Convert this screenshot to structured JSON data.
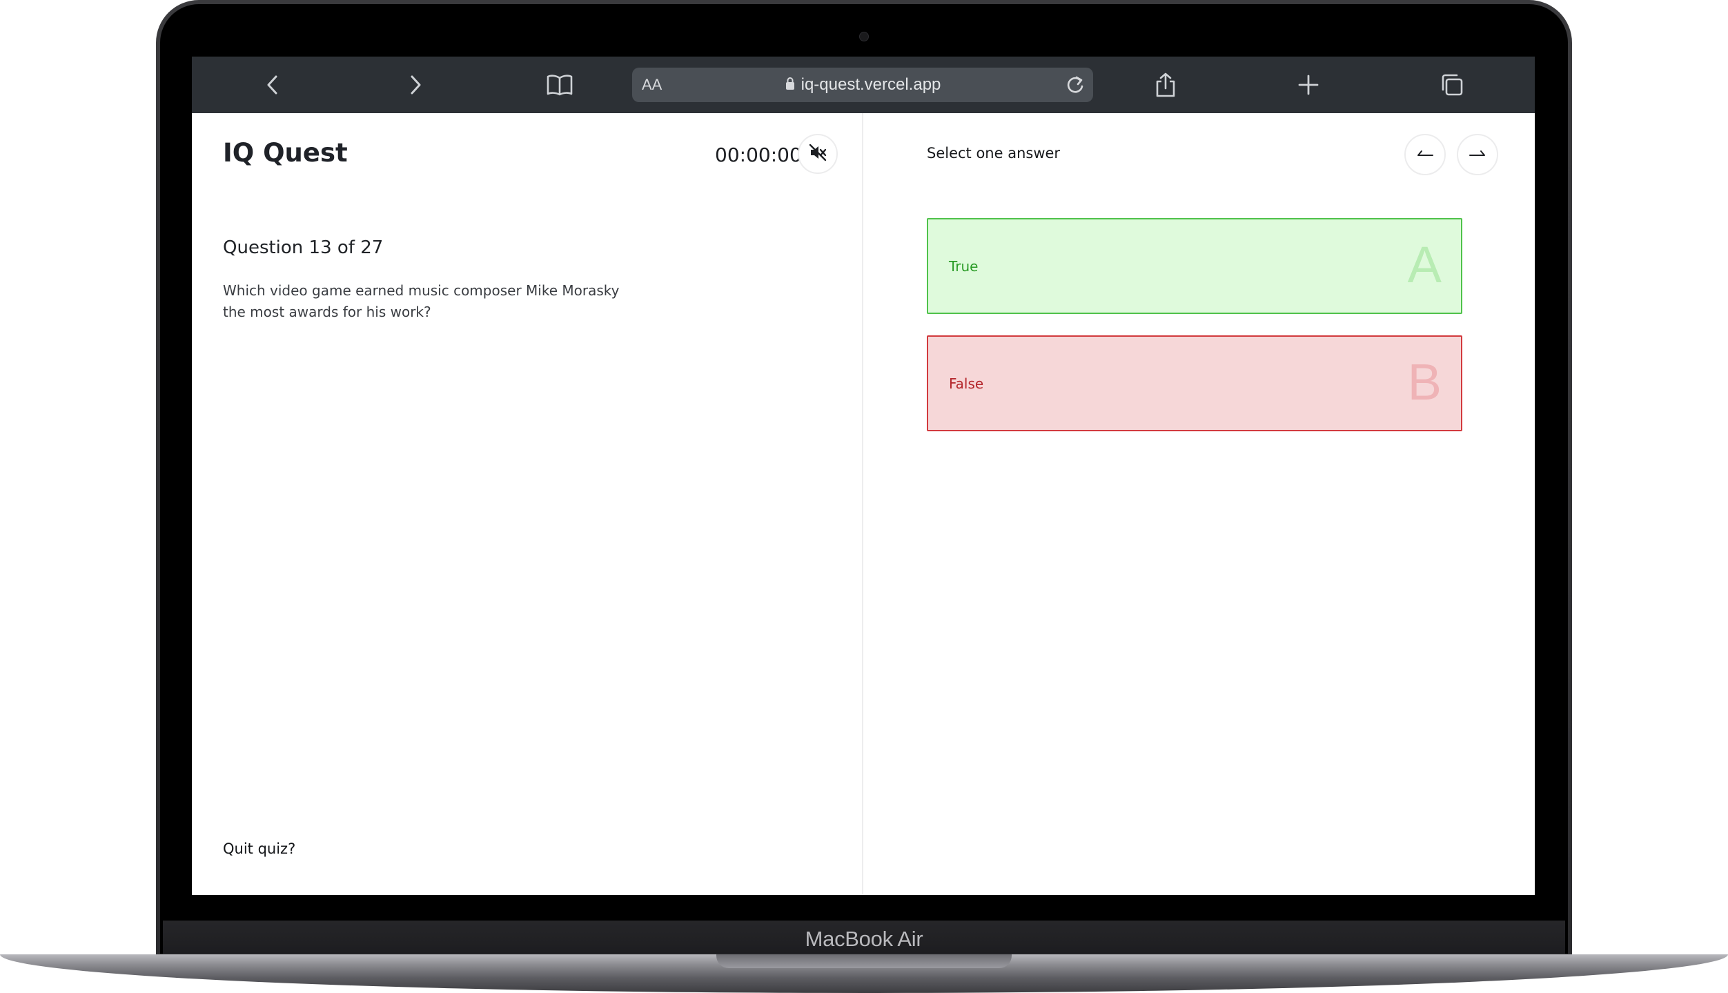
{
  "device": {
    "label": "MacBook Air"
  },
  "browser": {
    "text_size_label": "AA",
    "url": "iq-quest.vercel.app",
    "icons": [
      "chevron-left-icon",
      "chevron-right-icon",
      "book-icon",
      "lock-icon",
      "reload-icon",
      "share-icon",
      "plus-icon",
      "tabs-icon"
    ]
  },
  "app": {
    "title": "IQ Quest",
    "timer": "00:00:00",
    "mute_icon": "speaker-muted-icon"
  },
  "question": {
    "counter": "Question 13 of 27",
    "text": "Which video game earned music composer Mike Morasky the most awards for his work?"
  },
  "answers": {
    "instruction": "Select one answer",
    "options": [
      {
        "label": "True",
        "letter": "A",
        "state": "correct",
        "color": "#2b9c27"
      },
      {
        "label": "False",
        "letter": "B",
        "state": "incorrect",
        "color": "#b4262b"
      }
    ]
  },
  "nav": {
    "prev_icon": "arrow-left-icon",
    "next_icon": "arrow-right-icon"
  },
  "footer": {
    "quit_label": "Quit quiz?"
  }
}
